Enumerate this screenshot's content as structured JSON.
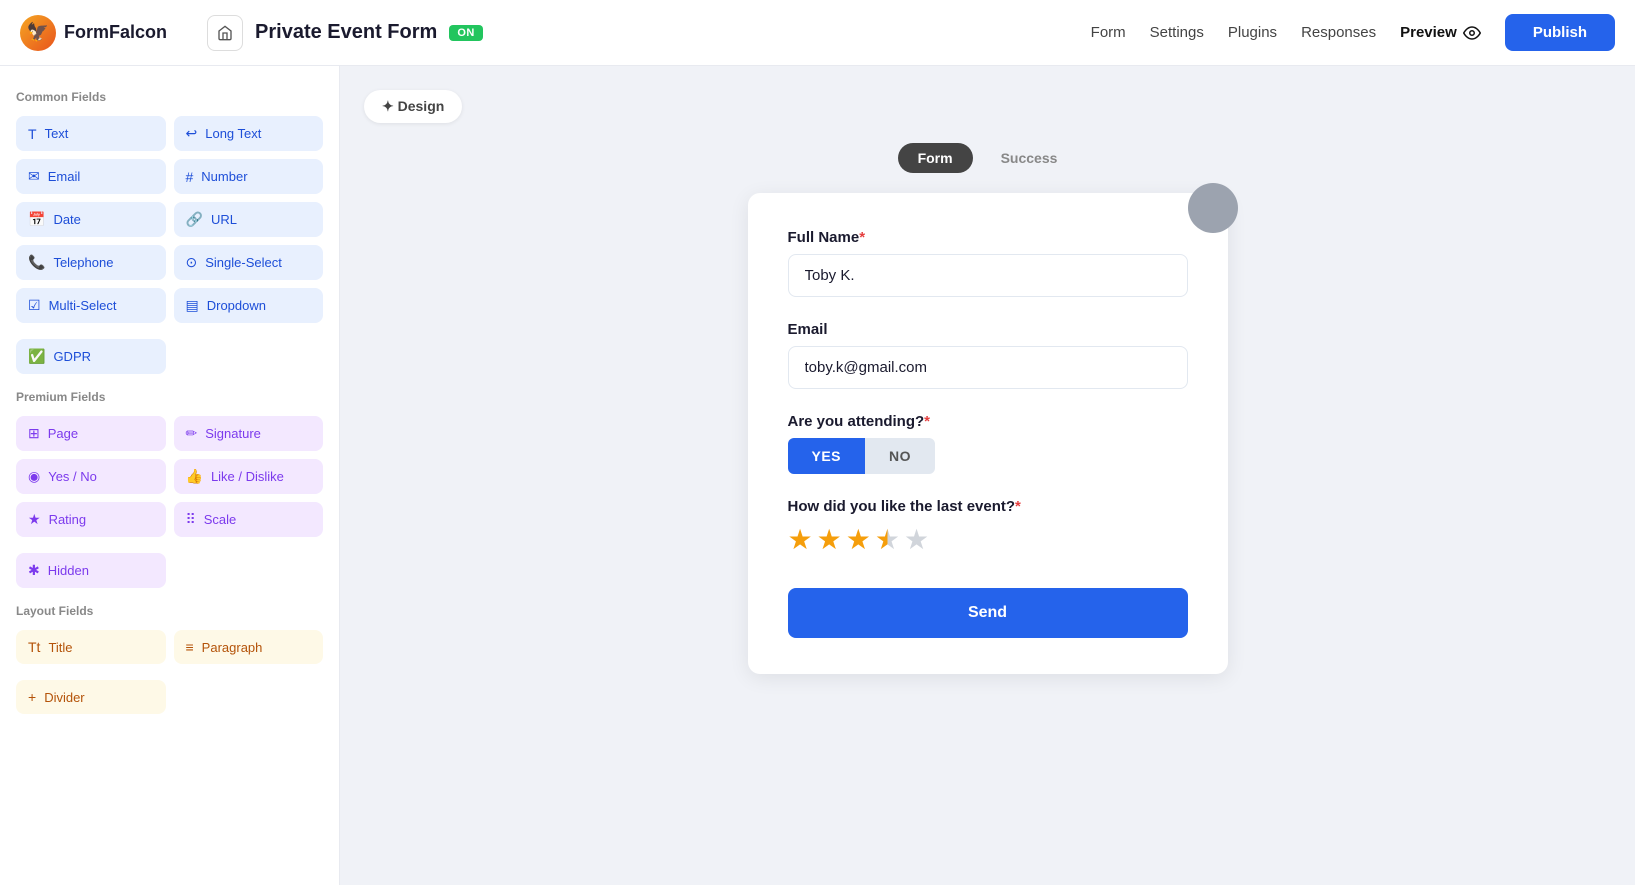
{
  "app": {
    "name": "FormFalcon",
    "logo_emoji": "🦅"
  },
  "navbar": {
    "form_title": "Private Event Form",
    "on_badge": "ON",
    "links": [
      "Form",
      "Settings",
      "Plugins",
      "Responses"
    ],
    "active_link": "Preview",
    "preview_label": "Preview",
    "publish_label": "Publish"
  },
  "sidebar": {
    "common_title": "Common Fields",
    "common_fields": [
      {
        "id": "text",
        "label": "Text",
        "icon": "T"
      },
      {
        "id": "long-text",
        "label": "Long Text",
        "icon": "↩"
      },
      {
        "id": "email",
        "label": "Email",
        "icon": "✉"
      },
      {
        "id": "number",
        "label": "Number",
        "icon": "#"
      },
      {
        "id": "date",
        "label": "Date",
        "icon": "📅"
      },
      {
        "id": "url",
        "label": "URL",
        "icon": "🔗"
      },
      {
        "id": "telephone",
        "label": "Telephone",
        "icon": "📞"
      },
      {
        "id": "single-select",
        "label": "Single-Select",
        "icon": "⊙"
      },
      {
        "id": "multi-select",
        "label": "Multi-Select",
        "icon": "☑"
      },
      {
        "id": "dropdown",
        "label": "Dropdown",
        "icon": "▤"
      },
      {
        "id": "gdpr",
        "label": "GDPR",
        "icon": "✅"
      }
    ],
    "premium_title": "Premium Fields",
    "premium_fields": [
      {
        "id": "page",
        "label": "Page",
        "icon": "⊞"
      },
      {
        "id": "signature",
        "label": "Signature",
        "icon": "✏"
      },
      {
        "id": "yes-no",
        "label": "Yes / No",
        "icon": "◉"
      },
      {
        "id": "like-dislike",
        "label": "Like / Dislike",
        "icon": "👍"
      },
      {
        "id": "rating",
        "label": "Rating",
        "icon": "★"
      },
      {
        "id": "scale",
        "label": "Scale",
        "icon": "⠿"
      },
      {
        "id": "hidden",
        "label": "Hidden",
        "icon": "✱"
      }
    ],
    "layout_title": "Layout Fields",
    "layout_fields": [
      {
        "id": "title",
        "label": "Title",
        "icon": "Tt"
      },
      {
        "id": "paragraph",
        "label": "Paragraph",
        "icon": "≡"
      },
      {
        "id": "divider",
        "label": "Divider",
        "icon": "+"
      }
    ]
  },
  "tabs": {
    "design_label": "✦ Design",
    "form_tab": "Form",
    "success_tab": "Success"
  },
  "form": {
    "full_name_label": "Full Name",
    "full_name_required": true,
    "full_name_value": "Toby K.",
    "email_label": "Email",
    "email_required": false,
    "email_value": "toby.k@gmail.com",
    "attending_label": "Are you attending?",
    "attending_required": true,
    "yes_label": "YES",
    "no_label": "NO",
    "rating_label": "How did you like the last event?",
    "rating_required": true,
    "rating_value": 3.5,
    "stars_total": 5,
    "send_label": "Send"
  }
}
